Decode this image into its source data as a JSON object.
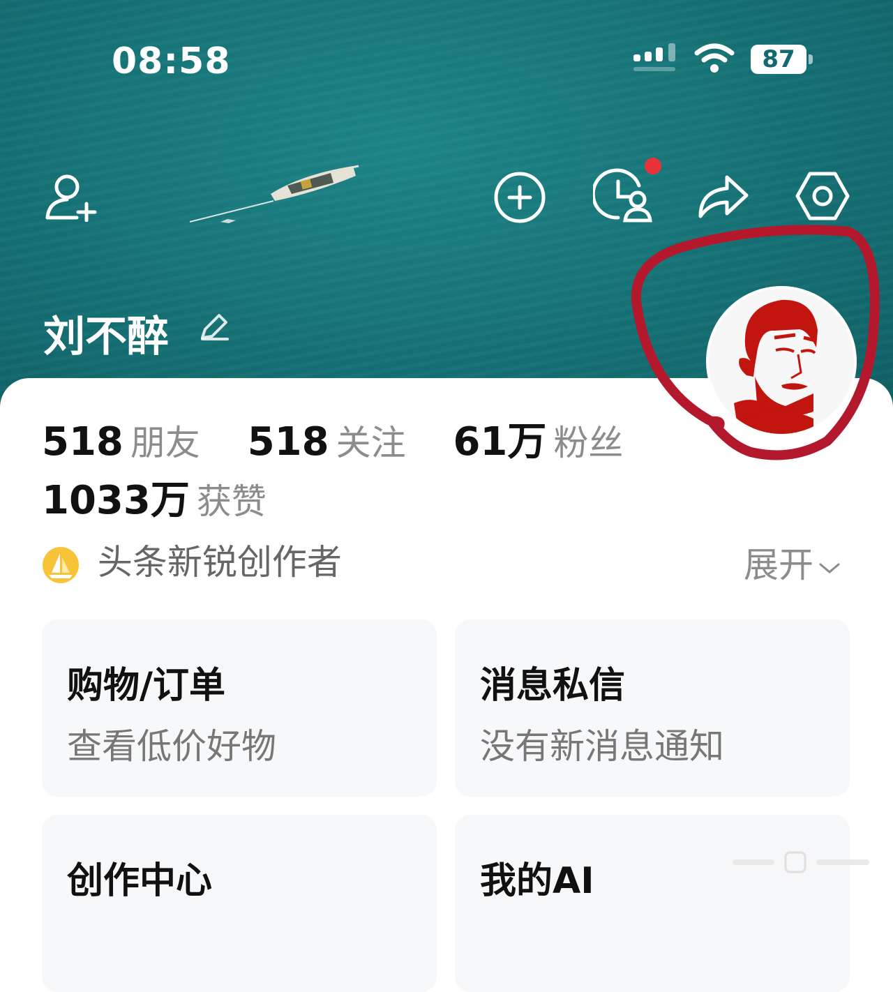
{
  "status_bar": {
    "time": "08:58",
    "battery": "87"
  },
  "colors": {
    "header_bg": "#17777a",
    "notification_dot": "#e8333a",
    "annotation_circle": "#b3182c",
    "badge_gold": "#f7c438"
  },
  "toolbar_icons": [
    "add-friend-icon",
    "plus-circle-icon",
    "history-icon",
    "share-icon",
    "settings-icon"
  ],
  "profile": {
    "username": "刘不醉",
    "stats": [
      {
        "num": "518",
        "label": "朋友"
      },
      {
        "num": "518",
        "label": "关注"
      },
      {
        "num": "61万",
        "label": "粉丝"
      }
    ],
    "likes": {
      "num": "1033万",
      "label": "获赞"
    },
    "badge": "头条新锐创作者",
    "expand": "展开"
  },
  "tiles": [
    {
      "title": "购物/订单",
      "subtitle": "查看低价好物"
    },
    {
      "title": "消息私信",
      "subtitle": "没有新消息通知"
    },
    {
      "title": "创作中心",
      "subtitle": ""
    },
    {
      "title": "我的AI",
      "subtitle": ""
    }
  ]
}
